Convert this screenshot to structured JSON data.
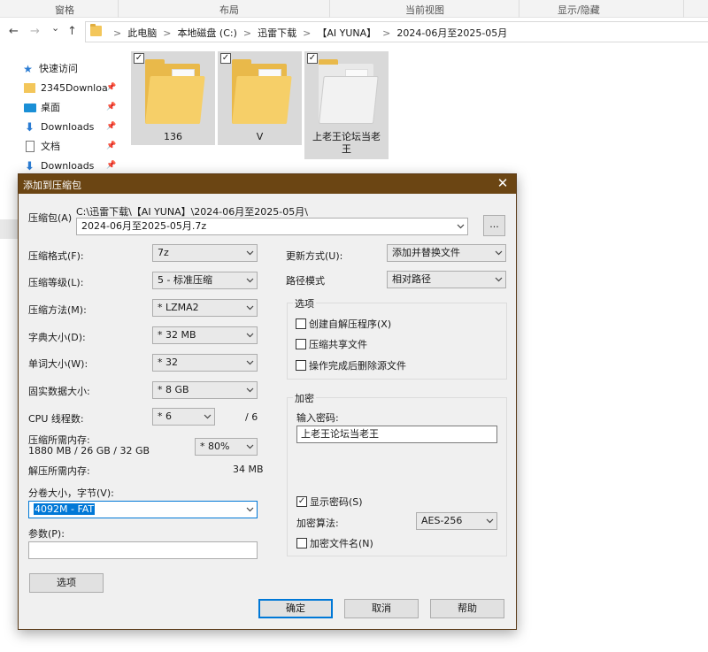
{
  "ribbon": {
    "tabs": [
      "窗格",
      "布局",
      "当前视图",
      "显示/隐藏"
    ]
  },
  "nav": {
    "back": "←",
    "forward": "→",
    "recent": "⌄",
    "up": "↑"
  },
  "address": {
    "crumbs": [
      "此电脑",
      "本地磁盘 (C:)",
      "迅雷下载",
      "【AI YUNA】",
      "2024-06月至2025-05月"
    ],
    "separator": ">"
  },
  "sidebar": {
    "items": [
      {
        "label": "快速访问",
        "icon": "star-icon"
      },
      {
        "label": "2345Downloa",
        "icon": "folder-icon"
      },
      {
        "label": "桌面",
        "icon": "desktop-icon"
      },
      {
        "label": "Downloads",
        "icon": "download-icon"
      },
      {
        "label": "文档",
        "icon": "document-icon"
      },
      {
        "label": "Downloads",
        "icon": "download-icon"
      }
    ]
  },
  "folders": [
    {
      "name": "136",
      "checked": true
    },
    {
      "name": "V",
      "checked": true
    },
    {
      "name": "上老王论坛当老王",
      "checked": true
    }
  ],
  "dialog": {
    "title": "添加到压缩包",
    "close": "✕",
    "archive": {
      "label": "压缩包(A)",
      "path": "C:\\迅雷下载\\【AI YUNA】\\2024-06月至2025-05月\\",
      "name": "2024-06月至2025-05月.7z",
      "browse": "..."
    },
    "left": {
      "format": {
        "label": "压缩格式(F):",
        "value": "7z"
      },
      "level": {
        "label": "压缩等级(L):",
        "value": "5 - 标准压缩"
      },
      "method": {
        "label": "压缩方法(M):",
        "value": "* LZMA2"
      },
      "dict": {
        "label": "字典大小(D):",
        "value": "* 32 MB"
      },
      "word": {
        "label": "单词大小(W):",
        "value": "* 32"
      },
      "solid": {
        "label": "固实数据大小:",
        "value": "* 8 GB"
      },
      "threads": {
        "label": "CPU 线程数:",
        "value": "* 6",
        "max": "/ 6"
      },
      "mem_comp": {
        "label": "压缩所需内存:",
        "detail": "1880 MB / 26 GB / 32 GB",
        "value": "* 80%"
      },
      "mem_decomp": {
        "label": "解压所需内存:",
        "value": "34 MB"
      },
      "split": {
        "label": "分卷大小，字节(V):",
        "value": "4092M - FAT"
      },
      "params": {
        "label": "参数(P):",
        "value": ""
      },
      "options_btn": "选项"
    },
    "right": {
      "update": {
        "label": "更新方式(U):",
        "value": "添加并替换文件"
      },
      "pathmode": {
        "label": "路径模式",
        "value": "相对路径"
      },
      "options": {
        "title": "选项",
        "sfx": {
          "label": "创建自解压程序(X)",
          "checked": false
        },
        "shared": {
          "label": "压缩共享文件",
          "checked": false
        },
        "delete": {
          "label": "操作完成后删除源文件",
          "checked": false
        }
      },
      "encryption": {
        "title": "加密",
        "pwd_label": "输入密码:",
        "pwd_value": "上老王论坛当老王",
        "show_pwd": {
          "label": "显示密码(S)",
          "checked": true
        },
        "algo_label": "加密算法:",
        "algo_value": "AES-256",
        "encrypt_names": {
          "label": "加密文件名(N)",
          "checked": false
        }
      }
    },
    "buttons": {
      "ok": "确定",
      "cancel": "取消",
      "help": "帮助"
    }
  }
}
